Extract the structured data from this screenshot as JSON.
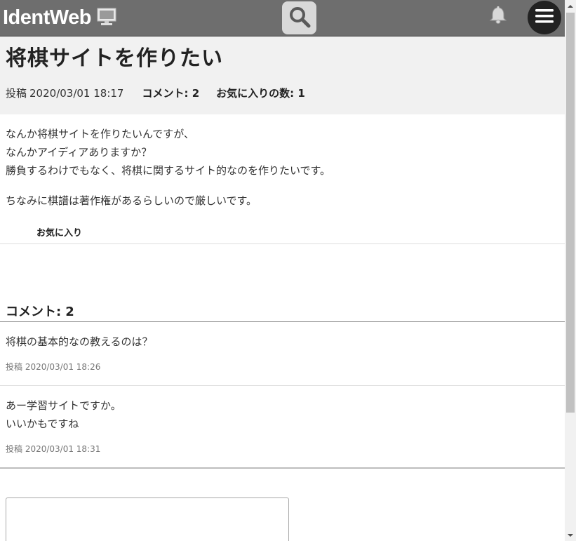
{
  "header": {
    "app_name": "IdentWeb",
    "logo_icon": "monitor-icon",
    "search_icon": "search-icon",
    "notification_icon": "bell-icon",
    "menu_icon": "hamburger-menu-icon",
    "colors": {
      "bar": "#6e6e6e",
      "search_bg": "#d9d9d9",
      "menu_bg": "#222222"
    }
  },
  "post": {
    "title": "将棋サイトを作りたい",
    "posted_label": "投稿",
    "posted_at": "2020/03/01 18:17",
    "comment_count_label": "コメント: 2",
    "favorites_label": "お気に入りの数: 1",
    "body_lines": [
      "なんか将棋サイトを作りたいんですが、",
      "なんかアイディアありますか？",
      "勝負するわけでもなく、将棋に関するサイト的なのを作りたいです。"
    ],
    "body_extra": "ちなみに棋譜は著作権があるらしいので厳しいです。",
    "favorite_button": "お気に入り"
  },
  "comments_section": {
    "heading": "コメント",
    "count": "2",
    "items": [
      {
        "lines": [
          "将棋の基本的なの教えるのは？"
        ],
        "posted": "投稿 2020/03/01 18:26"
      },
      {
        "lines": [
          "あー学習サイトですか。",
          "いいかもですね"
        ],
        "posted": "投稿 2020/03/01 18:31"
      }
    ],
    "input_placeholder": ""
  }
}
